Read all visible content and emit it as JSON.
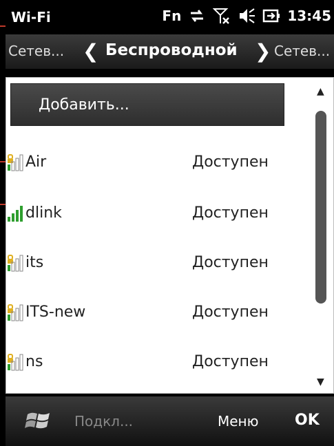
{
  "status_bar": {
    "title": "Wi-Fi",
    "fn_label": "Fn",
    "time": "13:45"
  },
  "header": {
    "prev_label": "Сетев...",
    "title": "Беспроводной",
    "next_label": "Сетев..."
  },
  "list": {
    "add_label": "Добавить...",
    "networks": [
      {
        "name": "Air",
        "status": "Доступен",
        "icon": "wifi-locked-weak-icon"
      },
      {
        "name": "dlink",
        "status": "Доступен",
        "icon": "wifi-open-strong-icon"
      },
      {
        "name": "its",
        "status": "Доступен",
        "icon": "wifi-locked-weak-icon"
      },
      {
        "name": "ITS-new",
        "status": "Доступен",
        "icon": "wifi-locked-weak-icon"
      },
      {
        "name": "ns",
        "status": "Доступен",
        "icon": "wifi-locked-weak-icon"
      }
    ]
  },
  "softbar": {
    "left_label": "Подкл...",
    "menu_label": "Меню",
    "ok_label": "OK"
  },
  "colors": {
    "annotation_line": "#c0392b",
    "signal_green": "#2e9e2e",
    "lock_yellow": "#e0b020"
  }
}
